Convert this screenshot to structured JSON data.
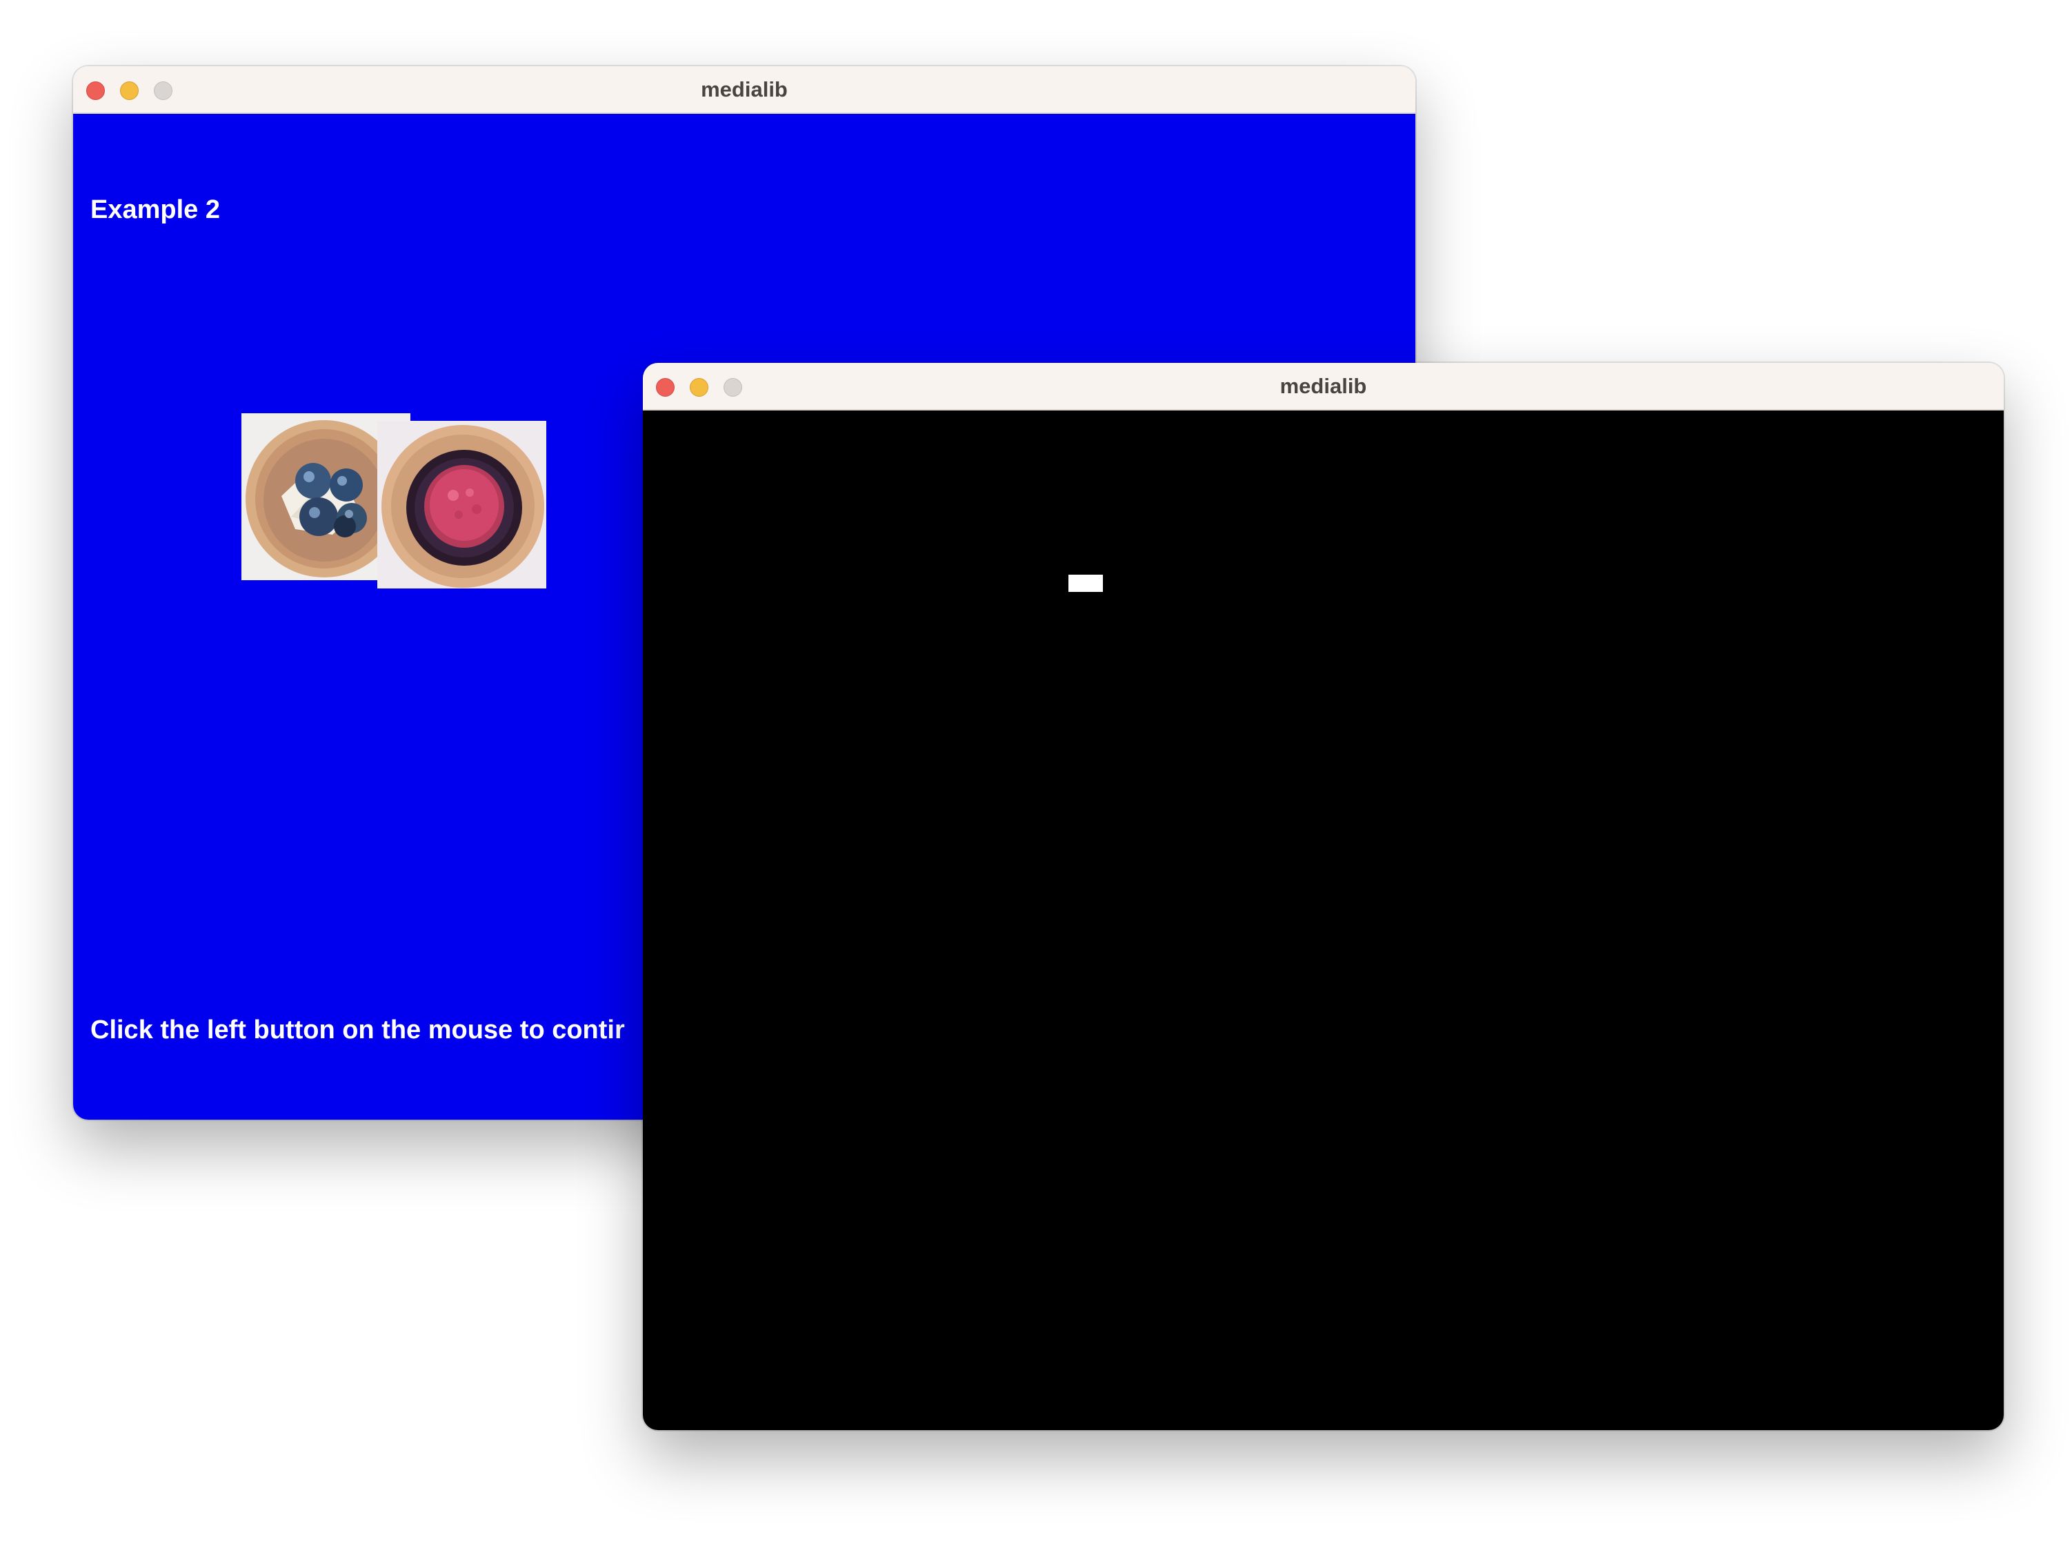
{
  "windows": {
    "back": {
      "title": "medialib",
      "background_color": "#0000ef",
      "heading": "Example 2",
      "instruction": "Click the left button on the mouse to contir",
      "images": [
        {
          "name": "blueberry-tart-image",
          "icon": "blueberry-tart"
        },
        {
          "name": "raspberry-tart-image",
          "icon": "raspberry-tart"
        }
      ]
    },
    "front": {
      "title": "medialib",
      "background_color": "#000000",
      "marker_color": "#ffffff"
    }
  },
  "traffic_lights": {
    "close_color": "#ee5f58",
    "minimize_color": "#f5bd3f",
    "zoom_color": "#d9d5d2"
  }
}
